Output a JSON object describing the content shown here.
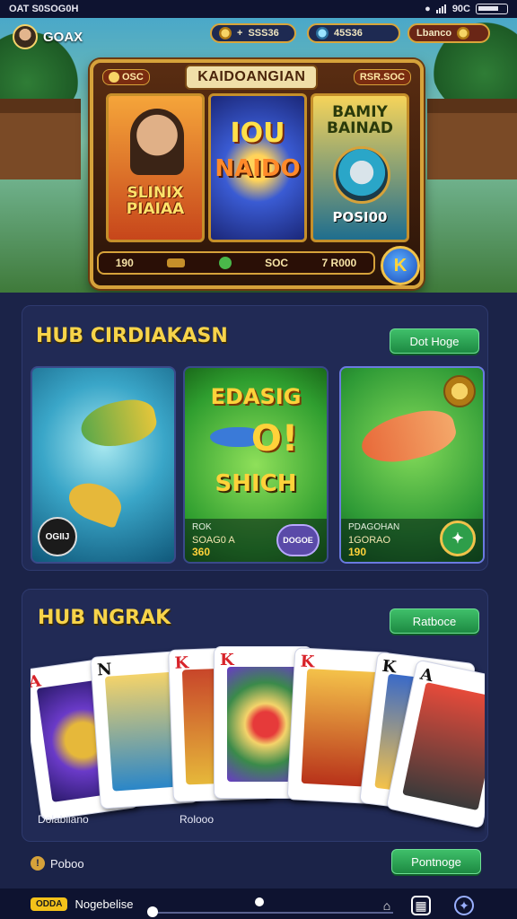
{
  "status_bar": {
    "left_text": "OAT  S0SOG0H",
    "right_text": "90C"
  },
  "hero": {
    "profile_name": "GOAX",
    "pill_coins": "SSS36",
    "pill_gems": "45S36",
    "pill_lobby": "Lbanco",
    "slot_title": "KAIDOANGIAN",
    "slot_mini_left": "OSC",
    "slot_mini_right": "RSR.SOC",
    "reel_1_text": "SLINIX PIAIAA",
    "reel_2_text_1": "IOU",
    "reel_2_text_2": "NAIDO",
    "reel_3_text_1": "BAMIY BAINAD",
    "reel_3_text_2": "POSI00",
    "bar_left": "190",
    "bar_mid": "SOC",
    "bar_right": "7 R000",
    "spin_glyph": "K"
  },
  "section_1": {
    "title": "HUB CIRDIAKASN",
    "button": "Dot Hoge",
    "tiles": [
      {
        "badge": "OGIIJ"
      },
      {
        "t1": "EDASIG",
        "t2": "O!",
        "t3": "SHICH",
        "name": "ROK",
        "sub": "SOAG0 A",
        "amount": "360",
        "badge": "DOGOE"
      },
      {
        "name": "PDAGOHAN",
        "sub": "1GORAO",
        "amount": "190",
        "badge": "✦"
      }
    ]
  },
  "section_2": {
    "title": "HUB NGRAK",
    "button": "Ratboce",
    "cards": [
      {
        "rank": "A",
        "suit": "red"
      },
      {
        "rank": "N",
        "suit": "black"
      },
      {
        "rank": "K",
        "suit": "red"
      },
      {
        "rank": "K",
        "suit": "red"
      },
      {
        "rank": "K",
        "suit": "red"
      },
      {
        "rank": "K",
        "suit": "black"
      },
      {
        "rank": "A",
        "suit": "black"
      }
    ],
    "label_left": "Dolabiiano",
    "label_right": "Rolooo"
  },
  "footer": {
    "info_label": "Poboo",
    "button": "Pontnoge"
  },
  "nav": {
    "chip": "ODDA",
    "label": "Nogebelise"
  }
}
